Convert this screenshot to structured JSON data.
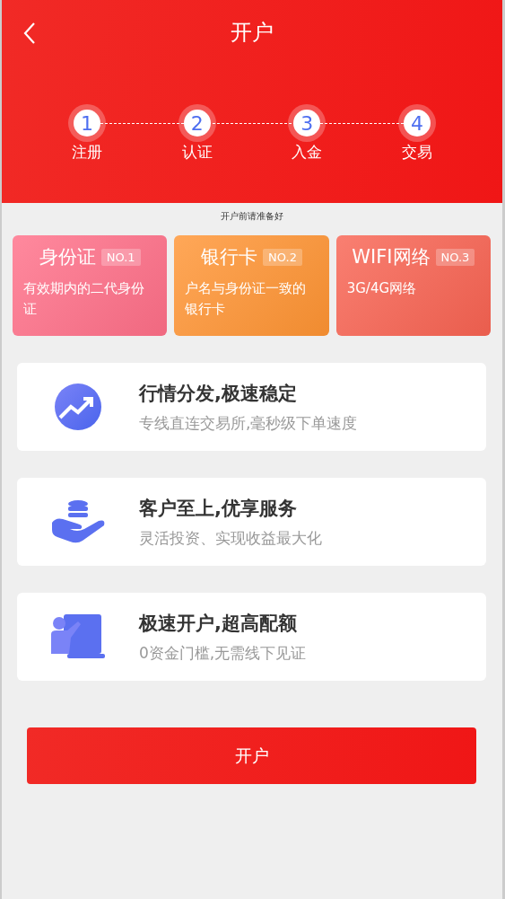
{
  "header": {
    "title": "开户"
  },
  "steps": [
    {
      "number": "1",
      "label": "注册"
    },
    {
      "number": "2",
      "label": "认证"
    },
    {
      "number": "3",
      "label": "入金"
    },
    {
      "number": "4",
      "label": "交易"
    }
  ],
  "notice": "开户前请准备好",
  "requirements": [
    {
      "title": "身份证",
      "badge": "NO.1",
      "text": "有效期内的二代身份证",
      "color": "#ff6f88"
    },
    {
      "title": "银行卡",
      "badge": "NO.2",
      "text": "户名与身份证一致的银行卡",
      "color": "#ff9433"
    },
    {
      "title": "WIFI网络",
      "badge": "NO.3",
      "text": "3G/4G网络",
      "color": "#f86352"
    }
  ],
  "features": [
    {
      "title": "行情分发,极速稳定",
      "text": "专线直连交易所,毫秒级下单速度"
    },
    {
      "title": "客户至上,优享服务",
      "text": "灵活投资、实现收益最大化"
    },
    {
      "title": "极速开户,超高配额",
      "text": "0资金门槛,无需线下见证"
    }
  ],
  "button": "开户"
}
